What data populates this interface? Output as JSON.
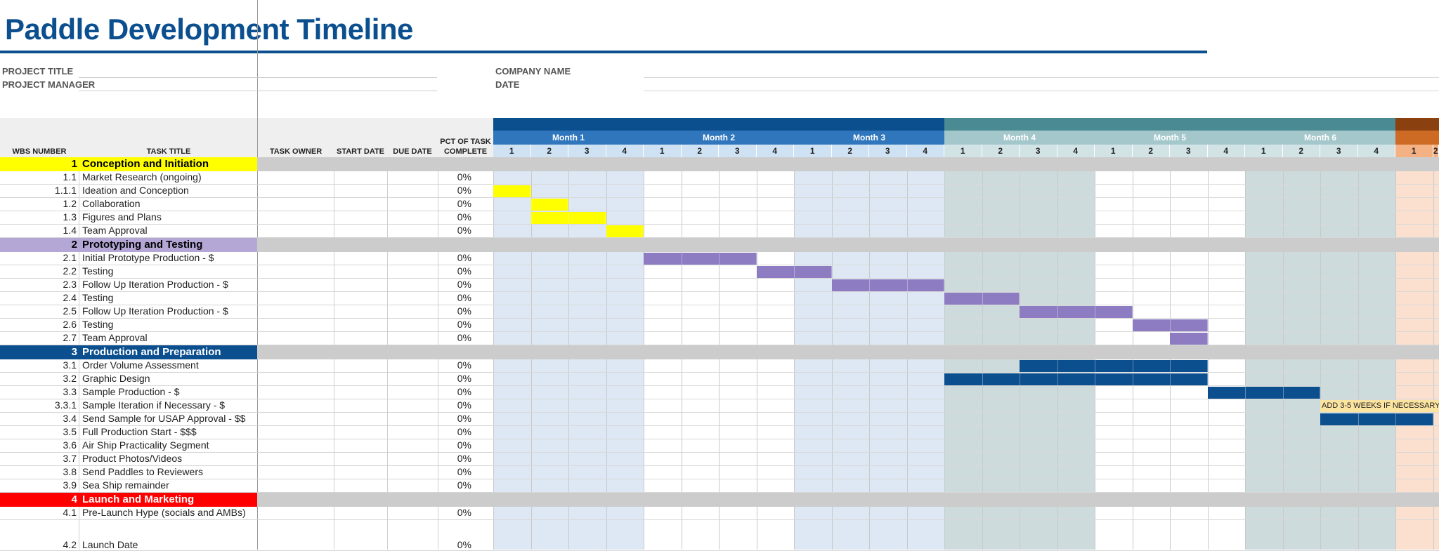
{
  "title": "Paddle Development Timeline",
  "labels": {
    "project_title": "PROJECT TITLE",
    "project_manager": "PROJECT MANAGER",
    "company_name": "COMPANY NAME",
    "date": "DATE"
  },
  "columns": {
    "wbs": "WBS NUMBER",
    "task": "TASK TITLE",
    "owner": "TASK OWNER",
    "start": "START DATE",
    "due": "DUE DATE",
    "pct_line1": "PCT OF TASK",
    "pct_line2": "COMPLETE"
  },
  "months": [
    {
      "label": "Month 1",
      "color": "#0b4f8f",
      "subcolor": "#2f76bd",
      "shade": "#dde8f4"
    },
    {
      "label": "Month 2",
      "color": "#0b4f8f",
      "subcolor": "#2f76bd",
      "shade": "#ffffff"
    },
    {
      "label": "Month 3",
      "color": "#0b4f8f",
      "subcolor": "#2f76bd",
      "shade": "#dde8f4"
    },
    {
      "label": "Month 4",
      "color": "#4a8a93",
      "subcolor": "#a3c7cb",
      "shade": "#cddbdd"
    },
    {
      "label": "Month 5",
      "color": "#4a8a93",
      "subcolor": "#a3c7cb",
      "shade": "#ffffff"
    },
    {
      "label": "Month 6",
      "color": "#4a8a93",
      "subcolor": "#a3c7cb",
      "shade": "#cddbdd"
    },
    {
      "label": "",
      "color": "#8b4010",
      "subcolor": "#cd6a24",
      "shade": "#fbe0d0"
    }
  ],
  "week_labels": [
    "1",
    "2",
    "3",
    "4"
  ],
  "rows": [
    {
      "type": "phase",
      "wbs": "1",
      "title": "Conception and Initiation",
      "color": "#ffff00",
      "text": "#000000"
    },
    {
      "type": "task",
      "wbs": "1.1",
      "title": "Market Research (ongoing)",
      "pct": "0%",
      "bars": []
    },
    {
      "type": "task",
      "wbs": "1.1.1",
      "title": "Ideation and Conception",
      "pct": "0%",
      "bars": [
        [
          0,
          1,
          "#ffff00"
        ]
      ]
    },
    {
      "type": "task",
      "wbs": "1.2",
      "title": "Collaboration",
      "pct": "0%",
      "bars": [
        [
          1,
          2,
          "#ffff00"
        ]
      ]
    },
    {
      "type": "task",
      "wbs": "1.3",
      "title": "Figures and Plans",
      "pct": "0%",
      "bars": [
        [
          1,
          3,
          "#ffff00"
        ]
      ]
    },
    {
      "type": "task",
      "wbs": "1.4",
      "title": "Team Approval",
      "pct": "0%",
      "bars": [
        [
          3,
          4,
          "#ffff00"
        ]
      ]
    },
    {
      "type": "phase",
      "wbs": "2",
      "title": "Prototyping and Testing",
      "color": "#b4a7d6",
      "text": "#000000"
    },
    {
      "type": "task",
      "wbs": "2.1",
      "title": "Initial Prototype Production - $",
      "pct": "0%",
      "bars": [
        [
          4,
          7,
          "#8e7cc3"
        ]
      ]
    },
    {
      "type": "task",
      "wbs": "2.2",
      "title": "Testing",
      "pct": "0%",
      "bars": [
        [
          7,
          9,
          "#8e7cc3"
        ]
      ]
    },
    {
      "type": "task",
      "wbs": "2.3",
      "title": "Follow Up Iteration Production - $",
      "pct": "0%",
      "bars": [
        [
          9,
          12,
          "#8e7cc3"
        ]
      ]
    },
    {
      "type": "task",
      "wbs": "2.4",
      "title": "Testing",
      "pct": "0%",
      "bars": [
        [
          12,
          14,
          "#8e7cc3"
        ]
      ]
    },
    {
      "type": "task",
      "wbs": "2.5",
      "title": "Follow Up Iteration Production - $",
      "pct": "0%",
      "bars": [
        [
          14,
          17,
          "#8e7cc3"
        ]
      ]
    },
    {
      "type": "task",
      "wbs": "2.6",
      "title": "Testing",
      "pct": "0%",
      "bars": [
        [
          17,
          19,
          "#8e7cc3"
        ]
      ]
    },
    {
      "type": "task",
      "wbs": "2.7",
      "title": "Team Approval",
      "pct": "0%",
      "bars": [
        [
          18,
          19,
          "#8e7cc3"
        ]
      ]
    },
    {
      "type": "phase",
      "wbs": "3",
      "title": "Production and Preparation",
      "color": "#0b4f8f",
      "text": "#ffffff"
    },
    {
      "type": "task",
      "wbs": "3.1",
      "title": "Order Volume Assessment",
      "pct": "0%",
      "bars": [
        [
          14,
          19,
          "#0b4f8f"
        ]
      ]
    },
    {
      "type": "task",
      "wbs": "3.2",
      "title": "Graphic Design",
      "pct": "0%",
      "bars": [
        [
          12,
          19,
          "#0b4f8f"
        ]
      ]
    },
    {
      "type": "task",
      "wbs": "3.3",
      "title": "Sample Production - $",
      "pct": "0%",
      "bars": [
        [
          19,
          22,
          "#0b4f8f"
        ]
      ]
    },
    {
      "type": "task",
      "wbs": "3.3.1",
      "title": "Sample Iteration if Necessary - $",
      "pct": "0%",
      "bars": [],
      "note": "ADD 3-5 WEEKS IF NECESSARY",
      "note_start": 22
    },
    {
      "type": "task",
      "wbs": "3.4",
      "title": "Send Sample for USAP Approval - $$",
      "pct": "0%",
      "bars": [
        [
          22,
          25,
          "#0b4f8f"
        ]
      ]
    },
    {
      "type": "task",
      "wbs": "3.5",
      "title": "Full Production Start - $$$",
      "pct": "0%",
      "bars": []
    },
    {
      "type": "task",
      "wbs": "3.6",
      "title": "Air Ship Practicality Segment",
      "pct": "0%",
      "bars": []
    },
    {
      "type": "task",
      "wbs": "3.7",
      "title": "Product Photos/Videos",
      "pct": "0%",
      "bars": []
    },
    {
      "type": "task",
      "wbs": "3.8",
      "title": "Send Paddles to Reviewers",
      "pct": "0%",
      "bars": []
    },
    {
      "type": "task",
      "wbs": "3.9",
      "title": "Sea Ship remainder",
      "pct": "0%",
      "bars": []
    },
    {
      "type": "phase",
      "wbs": "4",
      "title": "Launch and Marketing",
      "color": "#ff0000",
      "text": "#ffffff"
    },
    {
      "type": "task",
      "wbs": "4.1",
      "title": "Pre-Launch Hype (socials and AMBs)",
      "pct": "0%",
      "bars": []
    },
    {
      "type": "task",
      "wbs": "4.2",
      "title": "Launch Date",
      "pct": "0%",
      "bars": [],
      "tall": true
    }
  ]
}
